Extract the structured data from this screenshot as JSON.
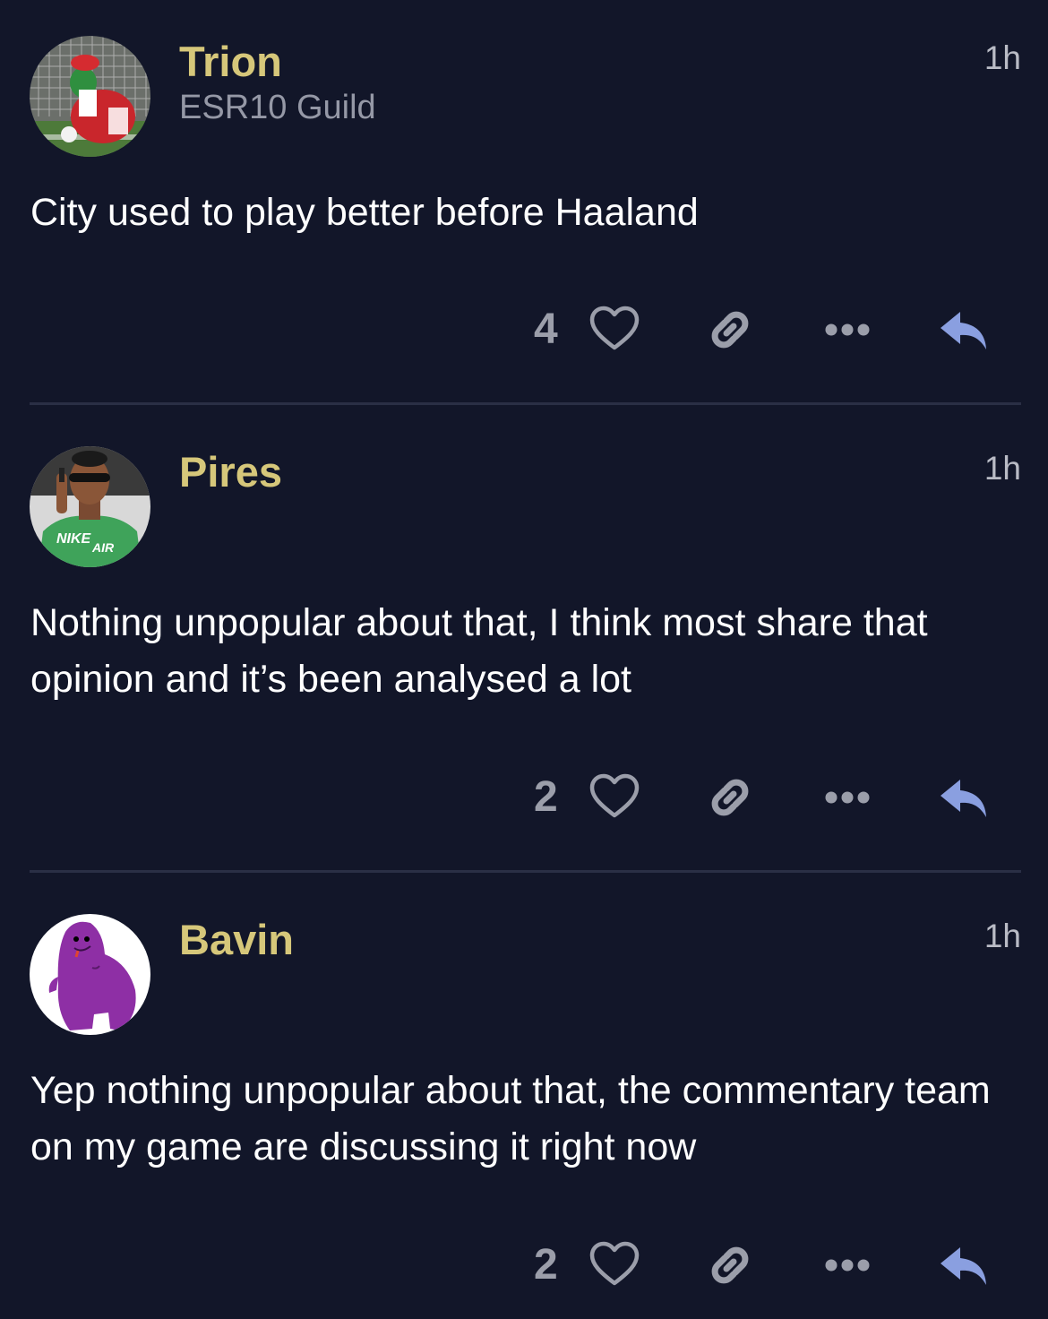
{
  "colors": {
    "background": "#121629",
    "username": "#d6c77a",
    "muted": "#9b9eaa",
    "reply_accent": "#8a9fe0"
  },
  "posts": [
    {
      "username": "Trion",
      "user_title": "ESR10 Guild",
      "time": "1h",
      "body": "City used to play better before Haaland",
      "likes": "4",
      "avatar": "avatar-photo-mascot"
    },
    {
      "username": "Pires",
      "user_title": "",
      "time": "1h",
      "body": "Nothing unpopular about that, I think most share that opinion and it’s been analysed a lot",
      "likes": "2",
      "avatar": "avatar-photo-man-phone"
    },
    {
      "username": "Bavin",
      "user_title": "",
      "time": "1h",
      "body": "Yep nothing unpopular about that, the commentary team on my game are discussing it right now",
      "likes": "2",
      "avatar": "avatar-purple-cartoon"
    }
  ],
  "icons": {
    "like": "heart-icon",
    "share": "link-icon",
    "more": "more-icon",
    "reply": "reply-icon"
  }
}
